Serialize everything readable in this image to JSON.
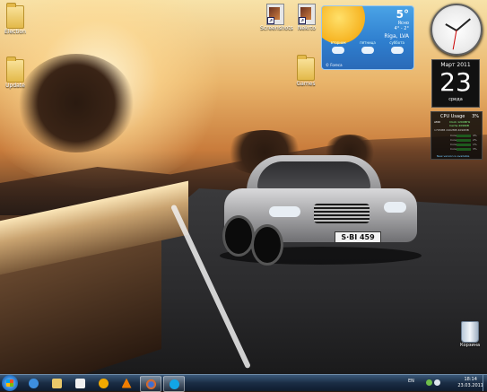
{
  "desktop_icons": [
    {
      "label": "Election",
      "type": "folder"
    },
    {
      "label": "Update",
      "type": "folder"
    },
    {
      "label": "Screenshots",
      "type": "file-shortcut"
    },
    {
      "label": "Nekrto",
      "type": "file-shortcut"
    },
    {
      "label": "Games",
      "type": "folder"
    }
  ],
  "recycle_bin": {
    "label": "Корзина"
  },
  "weather_gadget": {
    "temperature": "5°",
    "condition": "Ясно",
    "range": "4° - 2°",
    "city": "Riga, LVA",
    "forecast": [
      "вторник",
      "пятница",
      "суббота"
    ],
    "source": "© Foreca"
  },
  "calendar_gadget": {
    "month_year": "Март 2011",
    "day": "23",
    "weekday": "среда"
  },
  "cpu_gadget": {
    "title": "CPU Usage",
    "percent": "3%",
    "brand": "AMD",
    "rows": [
      "Clock 1200MHz",
      "Cache 4096KB",
      "1765MB 2402MB 4096MB"
    ],
    "cores": [
      "Core 1",
      "Core 2",
      "Core 3",
      "Core 4"
    ],
    "core_values": [
      "4%",
      "2%",
      "1%",
      "3%"
    ],
    "update_text": "New version is available"
  },
  "car": {
    "plate": "S·BI 459"
  },
  "taskbar": {
    "items": [
      "internet-explorer",
      "explorer",
      "media-player",
      "aimp",
      "vlc",
      "firefox",
      "skype"
    ],
    "active_items": [
      "firefox",
      "skype"
    ],
    "language": "EN",
    "time": "18:14",
    "date": "23.03.2011"
  },
  "colors": {
    "taskbar": "#1a2d44",
    "weather": "#2f7fcf"
  }
}
